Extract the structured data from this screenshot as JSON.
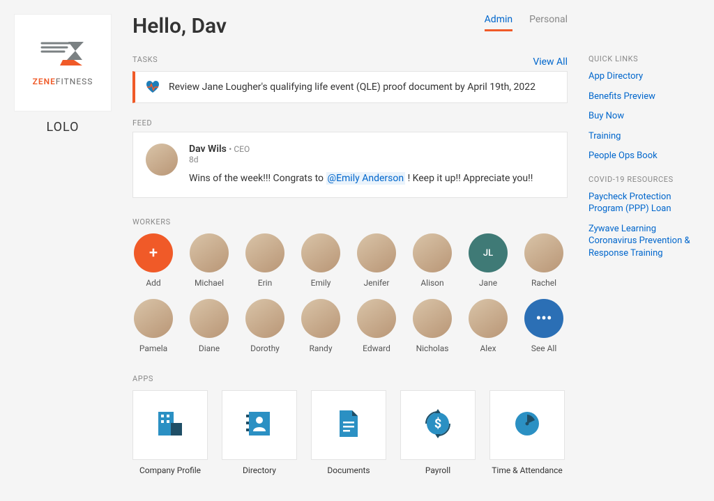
{
  "org": {
    "name": "LOLO",
    "brand_pre": "ZENE",
    "brand_suf": "FITNESS"
  },
  "header": {
    "greeting": "Hello, Dav",
    "tabs": {
      "admin": "Admin",
      "personal": "Personal"
    }
  },
  "tasks": {
    "label": "TASKS",
    "view_all": "View All",
    "items": [
      {
        "text": "Review Jane Lougher's qualifying life event (QLE) proof document by April 19th, 2022"
      }
    ]
  },
  "feed": {
    "label": "FEED",
    "post": {
      "author": "Dav Wils",
      "role": "CEO",
      "time": "8d",
      "body_pre": "Wins of the week!!! Congrats to ",
      "mention": "@Emily Anderson",
      "body_post": " ! Keep it up!! Appreciate you!!"
    }
  },
  "workers": {
    "label": "WORKERS",
    "add": "Add",
    "see_all": "See All",
    "list": [
      {
        "name": "Michael"
      },
      {
        "name": "Erin"
      },
      {
        "name": "Emily"
      },
      {
        "name": "Jenifer"
      },
      {
        "name": "Alison"
      },
      {
        "name": "Jane",
        "initials": "JL"
      },
      {
        "name": "Rachel"
      },
      {
        "name": "Pamela"
      },
      {
        "name": "Diane"
      },
      {
        "name": "Dorothy"
      },
      {
        "name": "Randy"
      },
      {
        "name": "Edward"
      },
      {
        "name": "Nicholas"
      },
      {
        "name": "Alex"
      }
    ]
  },
  "apps": {
    "label": "APPS",
    "list": [
      {
        "name": "Company Profile",
        "icon": "building-icon"
      },
      {
        "name": "Directory",
        "icon": "contact-icon"
      },
      {
        "name": "Documents",
        "icon": "document-icon"
      },
      {
        "name": "Payroll",
        "icon": "payroll-icon"
      },
      {
        "name": "Time & Attendance",
        "icon": "clock-icon"
      }
    ]
  },
  "quick_links": {
    "label": "QUICK LINKS",
    "items": [
      "App Directory",
      "Benefits Preview",
      "Buy Now",
      "Training",
      "People Ops Book"
    ]
  },
  "covid": {
    "label": "COVID-19 RESOURCES",
    "items": [
      "Paycheck Protection Program (PPP) Loan",
      "Zywave Learning Coronavirus Prevention & Response Training"
    ]
  }
}
